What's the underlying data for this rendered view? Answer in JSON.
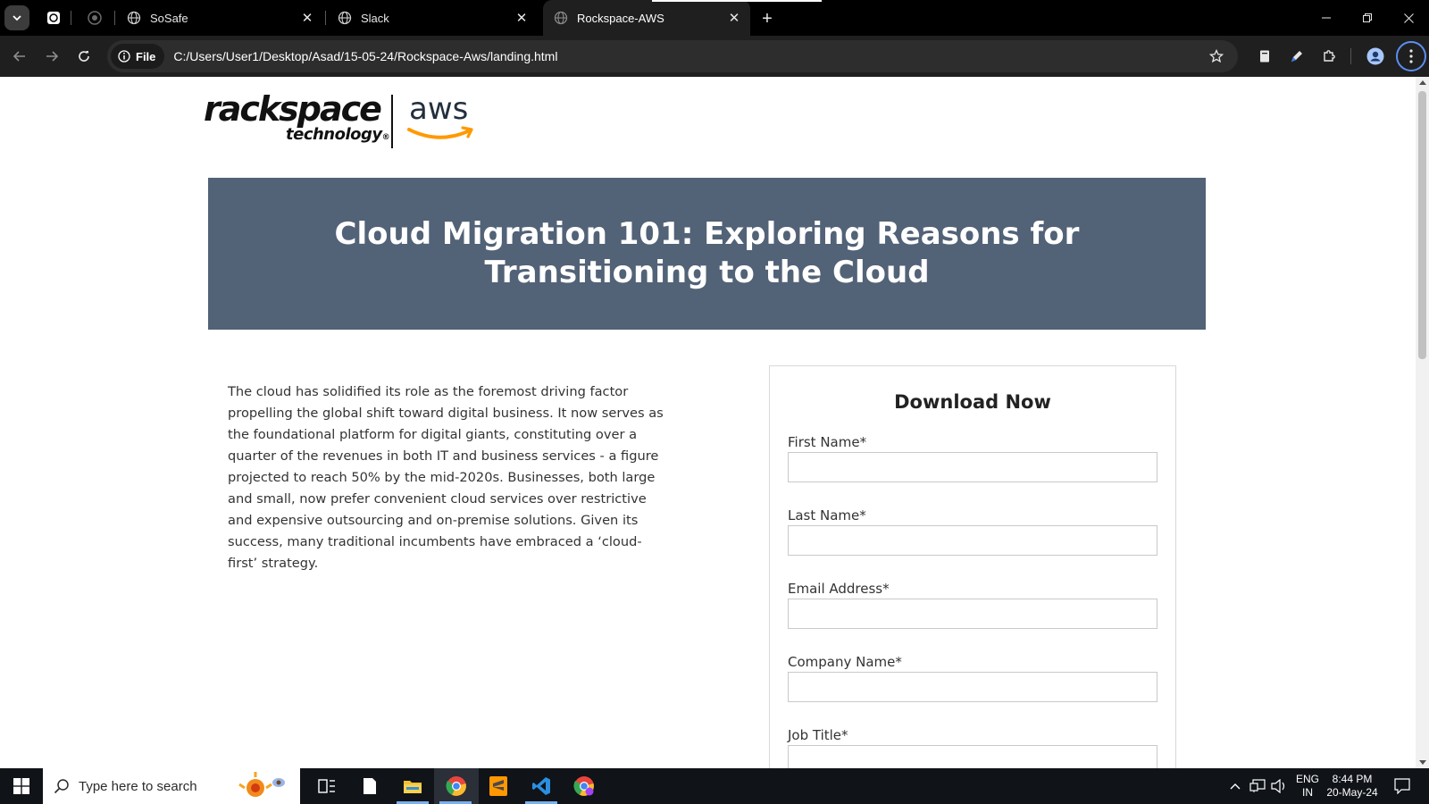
{
  "browser": {
    "tabs": [
      {
        "title": "SoSafe",
        "icon": "globe-icon"
      },
      {
        "title": "Slack",
        "icon": "globe-icon"
      },
      {
        "title": "Rockspace-AWS",
        "icon": "globe-icon",
        "active": true
      }
    ],
    "address": {
      "chip_label": "File",
      "url": "C:/Users/User1/Desktop/Asad/15-05-24/Rockspace-Aws/landing.html"
    }
  },
  "page": {
    "logo": {
      "brand": "rackspace",
      "sub": "technology",
      "registered": "®",
      "partner": "aws"
    },
    "hero_title": "Cloud Migration 101: Exploring Reasons for Transitioning to the Cloud",
    "intro_text": "The cloud has solidified its role as the foremost driving factor propelling the global shift toward digital business. It now serves as the foundational platform for digital giants, constituting over a quarter of the revenues in both IT and business services - a figure projected to reach 50% by the mid-2020s. Businesses, both large and small, now prefer convenient cloud services over restrictive and expensive outsourcing and on-premise solutions. Given its success, many traditional incumbents have embraced a ‘cloud-first’ strategy.",
    "form": {
      "title": "Download Now",
      "fields": [
        {
          "label": "First Name*",
          "value": ""
        },
        {
          "label": "Last Name*",
          "value": ""
        },
        {
          "label": "Email Address*",
          "value": ""
        },
        {
          "label": "Company Name*",
          "value": ""
        },
        {
          "label": "Job Title*",
          "value": ""
        }
      ]
    }
  },
  "taskbar": {
    "search_placeholder": "Type here to search",
    "language": "ENG",
    "region": "IN",
    "time": "8:44 PM",
    "date": "20-May-24"
  },
  "colors": {
    "hero_bg": "#526277",
    "aws_orange": "#ff9900",
    "tab_strip": "#000000",
    "toolbar": "#1f1f1f"
  }
}
